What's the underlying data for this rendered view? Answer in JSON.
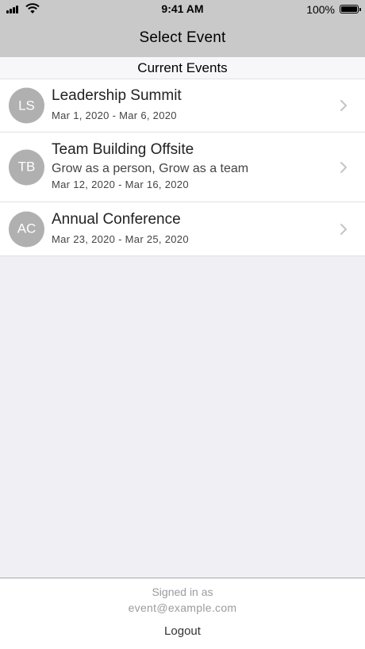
{
  "status_bar": {
    "time": "9:41 AM",
    "battery_text": "100%",
    "battery_level": 1.0
  },
  "nav": {
    "title": "Select Event"
  },
  "section": {
    "header": "Current Events"
  },
  "events": [
    {
      "initials": "LS",
      "title": "Leadership Summit",
      "subtitle": "",
      "dates": "Mar 1, 2020 - Mar 6, 2020"
    },
    {
      "initials": "TB",
      "title": "Team Building Offsite",
      "subtitle": "Grow as a person, Grow as a team",
      "dates": "Mar 12, 2020 - Mar 16, 2020"
    },
    {
      "initials": "AC",
      "title": "Annual Conference",
      "subtitle": "",
      "dates": "Mar 23, 2020 - Mar 25, 2020"
    }
  ],
  "footer": {
    "signed_in_label": "Signed in as",
    "email": "event@example.com",
    "logout_label": "Logout"
  },
  "colors": {
    "bar_background": "#c9c9c9",
    "avatar_background": "#b0b0b0",
    "list_background": "#efeff4"
  }
}
